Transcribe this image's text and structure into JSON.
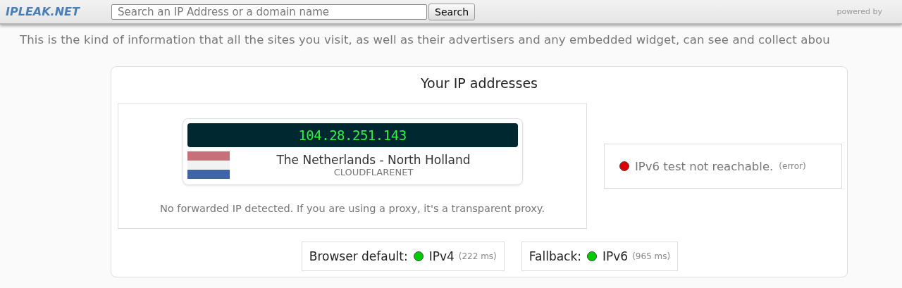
{
  "header": {
    "logo": "IPLEAK.NET",
    "search": {
      "placeholder": "Search an IP Address or a domain name"
    },
    "search_button": "Search",
    "powered_by": "powered by"
  },
  "intro": "This is the kind of information that all the sites you visit, as well as their advertisers and any embedded widget, can see and collect abou",
  "ip_panel": {
    "title": "Your IP addresses",
    "address": {
      "ip": "104.28.251.143",
      "location": "The Netherlands - North Holland",
      "isp": "CLOUDFLARENET"
    },
    "forwarded_note": "No forwarded IP detected. If you are using a proxy, it's a transparent proxy.",
    "ipv6_status": {
      "text": "IPv6 test not reachable.",
      "detail": "(error)",
      "color": "#dd0000"
    },
    "protocols": [
      {
        "label": "Browser default:",
        "protocol": "IPv4",
        "time": "(222 ms)",
        "color": "#00cc00"
      },
      {
        "label": "Fallback:",
        "protocol": "IPv6",
        "time": "(965 ms)",
        "color": "#00cc00"
      }
    ]
  }
}
